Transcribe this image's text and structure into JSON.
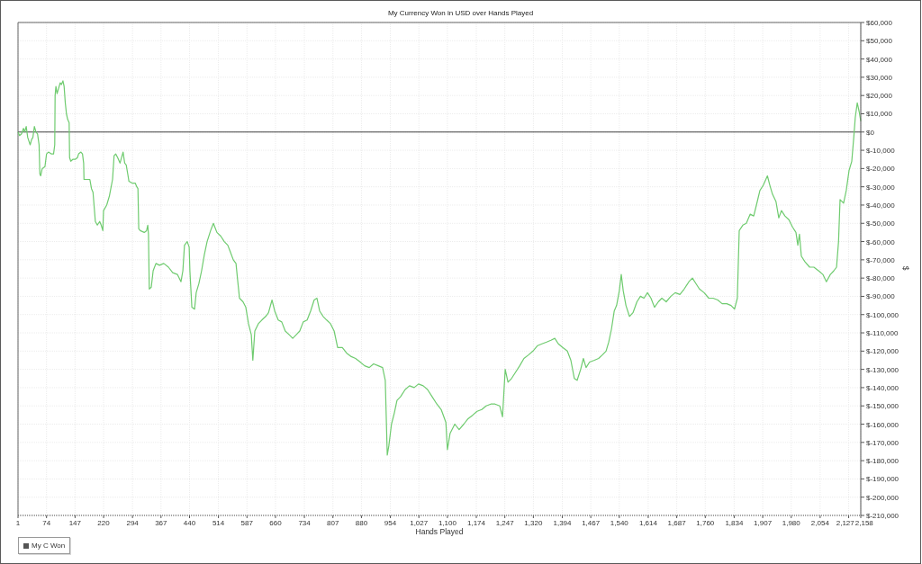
{
  "chart": {
    "chart_data": {
      "type": "line",
      "title": "My Currency Won in USD over Hands Played",
      "xlabel": "Hands Played",
      "ylabel": "$",
      "grid": true,
      "xlim": [
        1,
        2158
      ],
      "ylim": [
        -210000,
        60000
      ],
      "xticks": [
        1,
        74,
        147,
        220,
        294,
        367,
        440,
        514,
        587,
        660,
        734,
        807,
        880,
        954,
        {
          "value": 1027,
          "label": "1,027"
        },
        {
          "value": 1100,
          "label": "1,100"
        },
        {
          "value": 1174,
          "label": "1,174"
        },
        {
          "value": 1247,
          "label": "1,247"
        },
        {
          "value": 1320,
          "label": "1,320"
        },
        {
          "value": 1394,
          "label": "1,394"
        },
        {
          "value": 1467,
          "label": "1,467"
        },
        {
          "value": 1540,
          "label": "1,540"
        },
        {
          "value": 1614,
          "label": "1,614"
        },
        {
          "value": 1687,
          "label": "1,687"
        },
        {
          "value": 1760,
          "label": "1,760"
        },
        {
          "value": 1834,
          "label": "1,834"
        },
        {
          "value": 1907,
          "label": "1,907"
        },
        {
          "value": 1980,
          "label": "1,980"
        },
        {
          "value": 2054,
          "label": "2,054"
        },
        {
          "value": 2127,
          "label": "2,127"
        },
        {
          "value": 2158,
          "label": "2,158"
        }
      ],
      "yticks": [
        {
          "value": 60000,
          "label": "$60,000"
        },
        {
          "value": 50000,
          "label": "$50,000"
        },
        {
          "value": 40000,
          "label": "$40,000"
        },
        {
          "value": 30000,
          "label": "$30,000"
        },
        {
          "value": 20000,
          "label": "$20,000"
        },
        {
          "value": 10000,
          "label": "$10,000"
        },
        {
          "value": 0,
          "label": "$0"
        },
        {
          "value": -10000,
          "label": "$-10,000"
        },
        {
          "value": -20000,
          "label": "$-20,000"
        },
        {
          "value": -30000,
          "label": "$-30,000"
        },
        {
          "value": -40000,
          "label": "$-40,000"
        },
        {
          "value": -50000,
          "label": "$-50,000"
        },
        {
          "value": -60000,
          "label": "$-60,000"
        },
        {
          "value": -70000,
          "label": "$-70,000"
        },
        {
          "value": -80000,
          "label": "$-80,000"
        },
        {
          "value": -90000,
          "label": "$-90,000"
        },
        {
          "value": -100000,
          "label": "$-100,000"
        },
        {
          "value": -110000,
          "label": "$-110,000"
        },
        {
          "value": -120000,
          "label": "$-120,000"
        },
        {
          "value": -130000,
          "label": "$-130,000"
        },
        {
          "value": -140000,
          "label": "$-140,000"
        },
        {
          "value": -150000,
          "label": "$-150,000"
        },
        {
          "value": -160000,
          "label": "$-160,000"
        },
        {
          "value": -170000,
          "label": "$-170,000"
        },
        {
          "value": -180000,
          "label": "$-180,000"
        },
        {
          "value": -190000,
          "label": "$-190,000"
        },
        {
          "value": -200000,
          "label": "$-200,000"
        },
        {
          "value": -210000,
          "label": "$-210,000"
        }
      ],
      "x": [
        1,
        5,
        10,
        15,
        18,
        22,
        26,
        32,
        36,
        39,
        43,
        47,
        51,
        55,
        57,
        59,
        63,
        70,
        74,
        79,
        86,
        92,
        95,
        96,
        98,
        101,
        105,
        109,
        112,
        116,
        119,
        122,
        125,
        128,
        132,
        133,
        136,
        141,
        147,
        153,
        156,
        162,
        166,
        169,
        170,
        185,
        189,
        193,
        199,
        204,
        210,
        214,
        218,
        220,
        228,
        235,
        243,
        247,
        251,
        256,
        262,
        266,
        270,
        274,
        278,
        282,
        285,
        293,
        301,
        305,
        308,
        310,
        314,
        324,
        330,
        333,
        335,
        337,
        342,
        347,
        354,
        363,
        374,
        386,
        397,
        409,
        418,
        423,
        427,
        434,
        439,
        441,
        446,
        453,
        457,
        464,
        471,
        478,
        485,
        494,
        501,
        510,
        520,
        529,
        538,
        545,
        552,
        559,
        563,
        568,
        577,
        584,
        591,
        598,
        602,
        607,
        616,
        625,
        635,
        642,
        651,
        658,
        667,
        676,
        685,
        695,
        704,
        713,
        722,
        731,
        741,
        750,
        759,
        766,
        773,
        782,
        791,
        801,
        810,
        819,
        831,
        842,
        854,
        865,
        877,
        888,
        900,
        911,
        923,
        934,
        941,
        946,
        950,
        957,
        964,
        971,
        980,
        992,
        1003,
        1015,
        1026,
        1038,
        1049,
        1061,
        1073,
        1084,
        1096,
        1100,
        1107,
        1119,
        1130,
        1142,
        1153,
        1165,
        1176,
        1188,
        1199,
        1211,
        1222,
        1234,
        1241,
        1248,
        1255,
        1264,
        1273,
        1285,
        1296,
        1308,
        1319,
        1331,
        1342,
        1354,
        1365,
        1375,
        1384,
        1395,
        1407,
        1416,
        1425,
        1432,
        1441,
        1448,
        1455,
        1464,
        1476,
        1487,
        1497,
        1506,
        1513,
        1520,
        1527,
        1533,
        1540,
        1545,
        1550,
        1557,
        1566,
        1575,
        1585,
        1594,
        1603,
        1612,
        1621,
        1630,
        1640,
        1649,
        1660,
        1672,
        1683,
        1695,
        1706,
        1718,
        1727,
        1736,
        1745,
        1757,
        1769,
        1780,
        1792,
        1803,
        1815,
        1826,
        1835,
        1842,
        1847,
        1856,
        1865,
        1875,
        1884,
        1891,
        1900,
        1909,
        1919,
        1925,
        1932,
        1941,
        1948,
        1955,
        1964,
        1974,
        1983,
        1992,
        1997,
        2001,
        2006,
        2015,
        2027,
        2038,
        2050,
        2061,
        2070,
        2080,
        2089,
        2096,
        2101,
        2105,
        2114,
        2121,
        2128,
        2135,
        2140,
        2144,
        2149,
        2154,
        2158
      ],
      "series": [
        {
          "name": "My C Won",
          "color": "#6fcb6f",
          "values": [
            0,
            -2000,
            -1000,
            2000,
            0,
            3000,
            -3000,
            -7000,
            -4000,
            -3000,
            3000,
            0,
            -1000,
            -7000,
            -23000,
            -24000,
            -20000,
            -19000,
            -12000,
            -11000,
            -12000,
            -12000,
            -7000,
            20000,
            25000,
            21000,
            24000,
            27000,
            26000,
            28000,
            25000,
            16000,
            10000,
            7000,
            5000,
            -14000,
            -16000,
            -15000,
            -15000,
            -14000,
            -12000,
            -11000,
            -12000,
            -17000,
            -26000,
            -26000,
            -31000,
            -33000,
            -49000,
            -51000,
            -49000,
            -51000,
            -54000,
            -43000,
            -40000,
            -35000,
            -26000,
            -13000,
            -12000,
            -14000,
            -17000,
            -14000,
            -11000,
            -17000,
            -18000,
            -23000,
            -27000,
            -28000,
            -28000,
            -30000,
            -31000,
            -53000,
            -54000,
            -55000,
            -54000,
            -51000,
            -56000,
            -86000,
            -85000,
            -76000,
            -72000,
            -73000,
            -72000,
            -74000,
            -77000,
            -78000,
            -82000,
            -76000,
            -62000,
            -60000,
            -63000,
            -76000,
            -96000,
            -97000,
            -88000,
            -83000,
            -76000,
            -67000,
            -60000,
            -54000,
            -50000,
            -55000,
            -57000,
            -60000,
            -62000,
            -66000,
            -70000,
            -72000,
            -81000,
            -91000,
            -93000,
            -96000,
            -105000,
            -111000,
            -125000,
            -109000,
            -105000,
            -103000,
            -101000,
            -99000,
            -92000,
            -98000,
            -103000,
            -104000,
            -109000,
            -111000,
            -113000,
            -111000,
            -109000,
            -104000,
            -103000,
            -98000,
            -92000,
            -91000,
            -98000,
            -101000,
            -103000,
            -105000,
            -109000,
            -118000,
            -118000,
            -121000,
            -123000,
            -124000,
            -126000,
            -128000,
            -129000,
            -127000,
            -128000,
            -129000,
            -136000,
            -177000,
            -172000,
            -160000,
            -154000,
            -147000,
            -145000,
            -141000,
            -139000,
            -140000,
            -138000,
            -139000,
            -141000,
            -145000,
            -149000,
            -152000,
            -159000,
            -174000,
            -165000,
            -160000,
            -163000,
            -160000,
            -157000,
            -155000,
            -153000,
            -152000,
            -150000,
            -149000,
            -149000,
            -150000,
            -156000,
            -130000,
            -137000,
            -135000,
            -132000,
            -128000,
            -124000,
            -122000,
            -120000,
            -117000,
            -116000,
            -115000,
            -114000,
            -113000,
            -116000,
            -118000,
            -120000,
            -125000,
            -135000,
            -136000,
            -130000,
            -124000,
            -129000,
            -126000,
            -125000,
            -124000,
            -122000,
            -120000,
            -115000,
            -108000,
            -98000,
            -95000,
            -87000,
            -78000,
            -87000,
            -95000,
            -101000,
            -99000,
            -93000,
            -90000,
            -91000,
            -88000,
            -91000,
            -96000,
            -93000,
            -91000,
            -93000,
            -90000,
            -88000,
            -89000,
            -86000,
            -82000,
            -80000,
            -83000,
            -86000,
            -88000,
            -91000,
            -91000,
            -92000,
            -94000,
            -94000,
            -95000,
            -97000,
            -91000,
            -54000,
            -51000,
            -50000,
            -45000,
            -46000,
            -40000,
            -32000,
            -29000,
            -24000,
            -29000,
            -34000,
            -38000,
            -47000,
            -43000,
            -46000,
            -48000,
            -52000,
            -55000,
            -62000,
            -56000,
            -68000,
            -71000,
            -74000,
            -74000,
            -76000,
            -78000,
            -82000,
            -78000,
            -76000,
            -74000,
            -60000,
            -37000,
            -39000,
            -32000,
            -21000,
            -16000,
            -3000,
            8000,
            16000,
            11000,
            6000
          ]
        }
      ]
    }
  }
}
